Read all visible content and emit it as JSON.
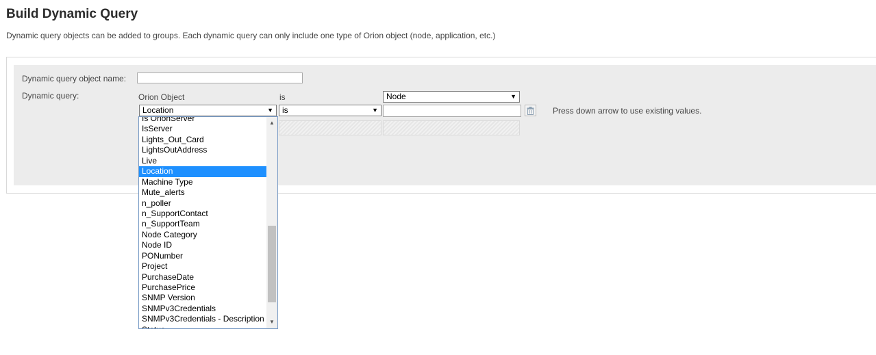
{
  "page": {
    "title": "Build Dynamic Query",
    "description": "Dynamic query objects can be added to groups. Each dynamic query can only include one type of Orion object (node, application, etc.)"
  },
  "form": {
    "name_label": "Dynamic query object name:",
    "name_value": "",
    "query_label": "Dynamic query:",
    "orion_object_label": "Orion Object",
    "is_label": "is",
    "object_type_value": "Node",
    "field_value": "Location",
    "operator_value": "is",
    "value_input": "",
    "hint": "Press down arrow to use existing values."
  },
  "dropdown": {
    "items": [
      "Is OrionServer",
      "IsServer",
      "Lights_Out_Card",
      "LightsOutAddress",
      "Live",
      "Location",
      "Machine Type",
      "Mute_alerts",
      "n_poller",
      "n_SupportContact",
      "n_SupportTeam",
      "Node Category",
      "Node ID",
      "PONumber",
      "Project",
      "PurchaseDate",
      "PurchasePrice",
      "SNMP Version",
      "SNMPv3Credentials",
      "SNMPv3Credentials - Description",
      "Status"
    ],
    "selected": "Location"
  },
  "icons": {
    "delete": "trash-icon",
    "dropdown_arrow": "caret-down-icon",
    "scroll_up": "scroll-up-arrow-icon",
    "scroll_down": "scroll-down-arrow-icon"
  },
  "colors": {
    "selection": "#1e90ff",
    "panel": "#ececec"
  }
}
